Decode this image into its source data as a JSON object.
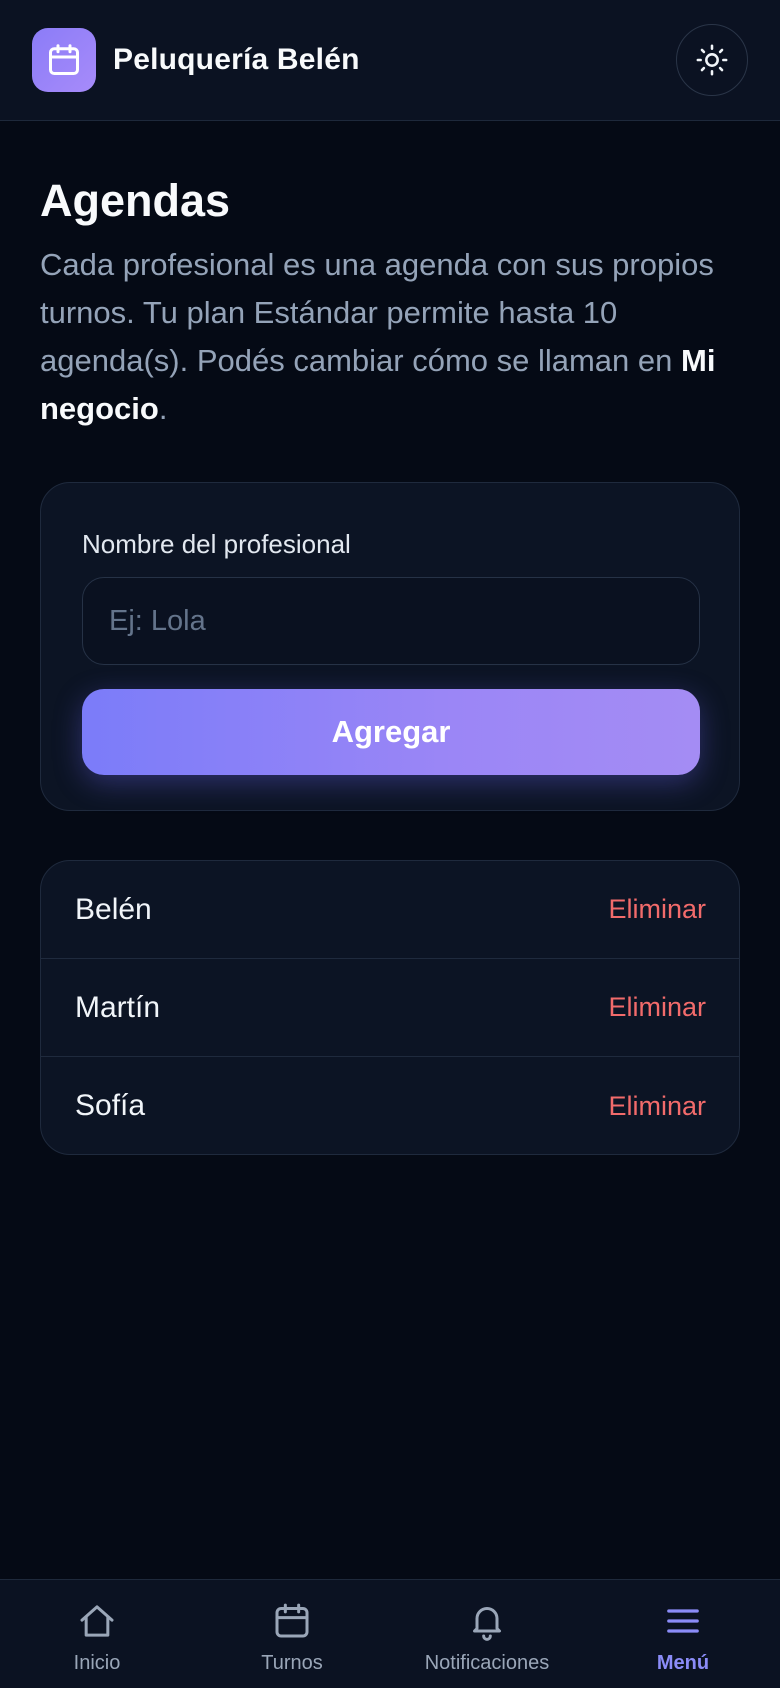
{
  "header": {
    "business_name": "Peluquería Belén"
  },
  "page": {
    "title": "Agendas",
    "description_part1": "Cada profesional es una agenda con sus propios turnos. Tu plan Estándar permite hasta 10 agenda(s). Podés cambiar cómo se llaman en ",
    "description_link": "Mi negocio",
    "description_end": "."
  },
  "form": {
    "label": "Nombre del profesional",
    "placeholder": "Ej: Lola",
    "value": "",
    "submit_label": "Agregar"
  },
  "agendas": [
    {
      "name": "Belén",
      "delete_label": "Eliminar"
    },
    {
      "name": "Martín",
      "delete_label": "Eliminar"
    },
    {
      "name": "Sofía",
      "delete_label": "Eliminar"
    }
  ],
  "nav": {
    "items": [
      {
        "label": "Inicio",
        "icon": "home-icon"
      },
      {
        "label": "Turnos",
        "icon": "calendar-icon"
      },
      {
        "label": "Notificaciones",
        "icon": "bell-icon"
      },
      {
        "label": "Menú",
        "icon": "menu-icon",
        "active": true
      }
    ]
  },
  "colors": {
    "accent": "#8b8cf8",
    "danger": "#f26b6b",
    "background": "#050a15"
  }
}
